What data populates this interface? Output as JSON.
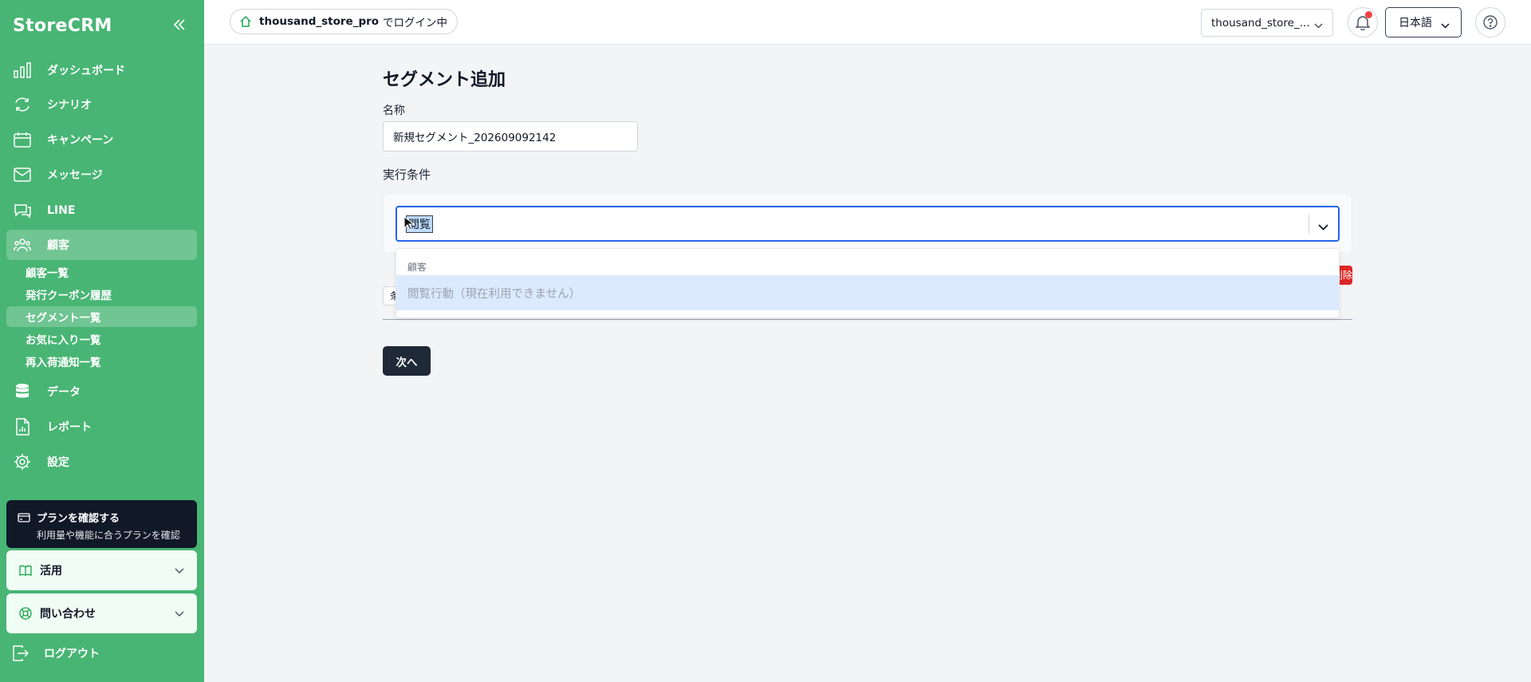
{
  "sidebar": {
    "brand": "StoreCRM",
    "nav": [
      {
        "label": "ダッシュボード",
        "icon": "chart-bar-icon"
      },
      {
        "label": "シナリオ",
        "icon": "refresh-icon"
      },
      {
        "label": "キャンペーン",
        "icon": "calendar-icon"
      },
      {
        "label": "メッセージ",
        "icon": "mail-icon"
      },
      {
        "label": "LINE",
        "icon": "chat-icon"
      },
      {
        "label": "顧客",
        "icon": "users-icon"
      }
    ],
    "sub_items": [
      {
        "label": "顧客一覧"
      },
      {
        "label": "発行クーポン履歴"
      },
      {
        "label": "セグメント一覧"
      },
      {
        "label": "お気に入り一覧"
      },
      {
        "label": "再入荷通知一覧"
      }
    ],
    "nav_bottom": [
      {
        "label": "データ",
        "icon": "database-icon"
      },
      {
        "label": "レポート",
        "icon": "report-icon"
      },
      {
        "label": "設定",
        "icon": "gear-icon"
      }
    ],
    "plan": {
      "title": "プランを確認する",
      "subtitle": "利用量や機能に合うプランを確認"
    },
    "accordions": [
      {
        "label": "活用",
        "icon": "book-icon"
      },
      {
        "label": "問い合わせ",
        "icon": "support-icon"
      }
    ],
    "logout": "ログアウト"
  },
  "header": {
    "login_user": "thousand_store_pro",
    "login_suffix": "でログイン中",
    "store_select": "thousand_store_...",
    "language": "日本語"
  },
  "main": {
    "title": "セグメント追加",
    "name_label": "名称",
    "name_value": "新規セグメント_202609092142",
    "conditions_label": "実行条件",
    "combo_value": "閲覧",
    "dropdown_group": "顧客",
    "dropdown_option": "閲覧行動（現在利用できません）",
    "hidden_row_text": "条",
    "hidden_delete": "削除",
    "next_button": "次へ"
  },
  "colors": {
    "sidebar_bg": "#48b574",
    "focus_border": "#2563eb",
    "option_highlight": "#dbeafe",
    "primary_button": "#1f2937",
    "notification_dot": "#ef4444"
  }
}
